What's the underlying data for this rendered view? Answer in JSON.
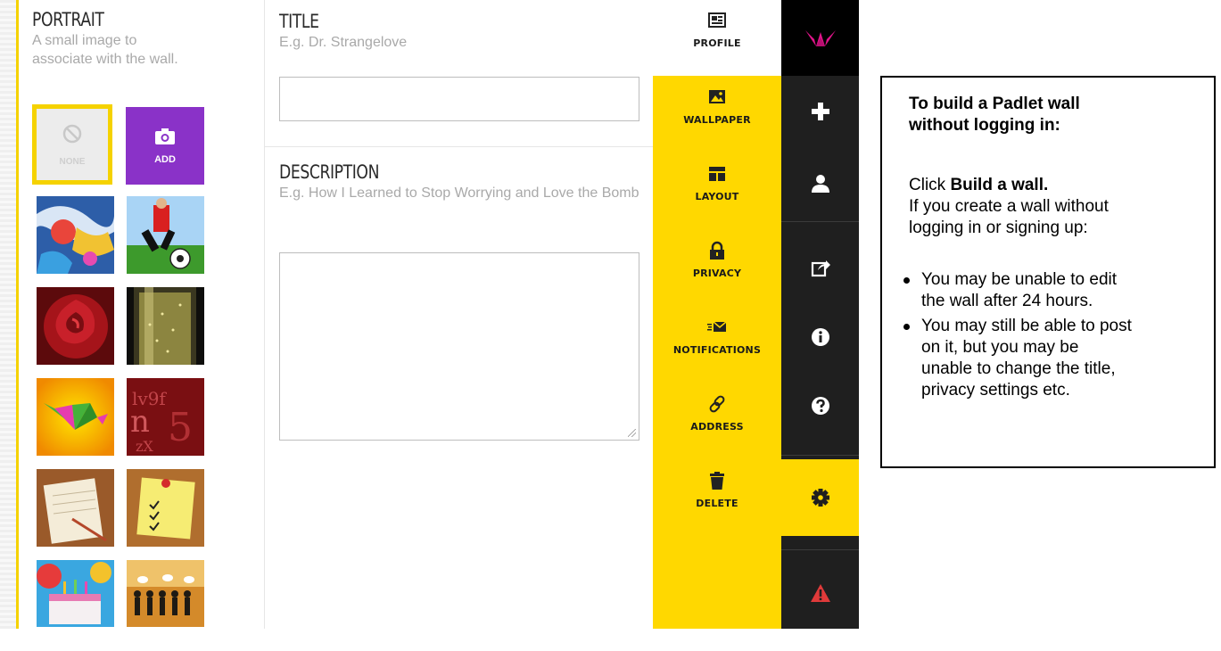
{
  "portrait": {
    "title": "PORTRAIT",
    "description_line1": "A small image to",
    "description_line2": "associate with the wall.",
    "none_label": "NONE",
    "add_label": "ADD"
  },
  "form": {
    "title_label": "TITLE",
    "title_hint": "E.g. Dr. Strangelove",
    "title_value": "",
    "description_label": "DESCRIPTION",
    "description_hint": "E.g. How I Learned to Stop Worrying and Love the Bomb",
    "description_value": ""
  },
  "settings_menu": {
    "items": [
      {
        "label": "PROFILE",
        "icon": "profile-icon"
      },
      {
        "label": "WALLPAPER",
        "icon": "wallpaper-icon"
      },
      {
        "label": "LAYOUT",
        "icon": "layout-icon"
      },
      {
        "label": "PRIVACY",
        "icon": "lock-icon"
      },
      {
        "label": "NOTIFICATIONS",
        "icon": "envelope-icon"
      },
      {
        "label": "ADDRESS",
        "icon": "link-icon"
      },
      {
        "label": "DELETE",
        "icon": "trash-icon"
      }
    ],
    "active": "PROFILE",
    "accent_color": "#ffd800"
  },
  "toolbar": {
    "buttons": [
      "logo",
      "plus",
      "user",
      "share",
      "info",
      "help",
      "settings",
      "alert"
    ],
    "active": "settings",
    "background_color": "#1f1f1f",
    "logo_color": "#e0148a",
    "alert_color": "#e03a3a"
  },
  "info_box": {
    "heading_line1": "To build a Padlet wall",
    "heading_line2": "without logging in:",
    "click_prefix": "Click ",
    "click_bold": "Build a wall.",
    "body_line1": "If you create a wall without",
    "body_line2": "logging in or signing up:",
    "bullets": [
      [
        "You may be unable to edit",
        "the wall after 24 hours."
      ],
      [
        "You may still be able to post",
        "on it, but you may be",
        "unable to change the title,",
        "privacy settings etc."
      ]
    ]
  }
}
